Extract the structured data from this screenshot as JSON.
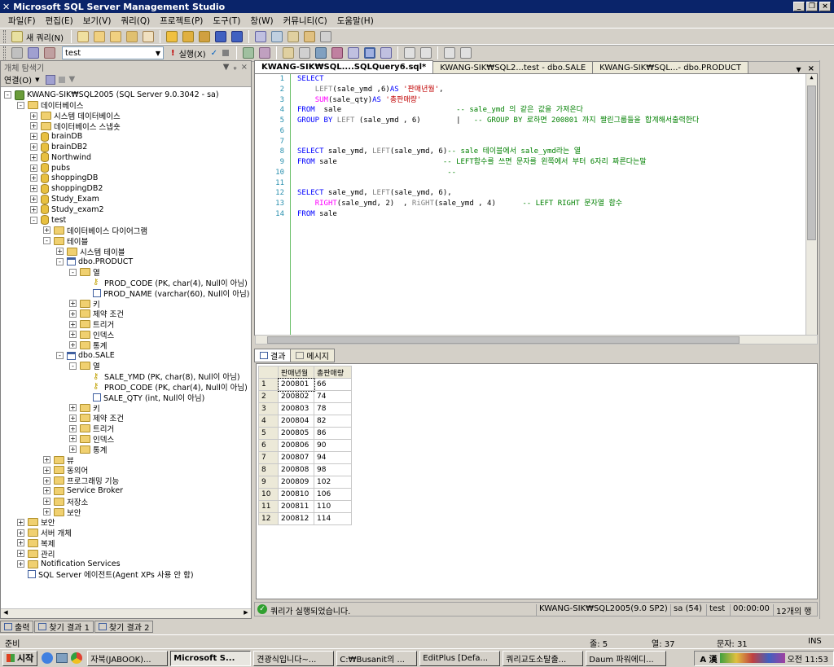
{
  "window": {
    "title": "Microsoft SQL Server Management Studio"
  },
  "menu": [
    "파일(F)",
    "편집(E)",
    "보기(V)",
    "쿼리(Q)",
    "프로젝트(P)",
    "도구(T)",
    "창(W)",
    "커뮤니티(C)",
    "도움말(H)"
  ],
  "toolbar1": {
    "new_query": "새 쿼리(N)"
  },
  "toolbar2": {
    "database": "test",
    "execute": "실행(X)"
  },
  "object_explorer": {
    "title": "개체 탐색기",
    "connect": "연결(O)",
    "tree": [
      {
        "level": 0,
        "exp": "-",
        "icon": "srv",
        "label": "KWANG-SIK₩SQL2005 (SQL Server 9.0.3042 - sa)"
      },
      {
        "level": 1,
        "exp": "-",
        "icon": "fold",
        "label": "데이터베이스"
      },
      {
        "level": 2,
        "exp": "+",
        "icon": "fold",
        "label": "시스템 데이터베이스"
      },
      {
        "level": 2,
        "exp": "+",
        "icon": "fold",
        "label": "데이터베이스 스냅숏"
      },
      {
        "level": 2,
        "exp": "+",
        "icon": "db",
        "label": "brainDB"
      },
      {
        "level": 2,
        "exp": "+",
        "icon": "db",
        "label": "brainDB2"
      },
      {
        "level": 2,
        "exp": "+",
        "icon": "db",
        "label": "Northwind"
      },
      {
        "level": 2,
        "exp": "+",
        "icon": "db",
        "label": "pubs"
      },
      {
        "level": 2,
        "exp": "+",
        "icon": "db",
        "label": "shoppingDB"
      },
      {
        "level": 2,
        "exp": "+",
        "icon": "db",
        "label": "shoppingDB2"
      },
      {
        "level": 2,
        "exp": "+",
        "icon": "db",
        "label": "Study_Exam"
      },
      {
        "level": 2,
        "exp": "+",
        "icon": "db",
        "label": "Study_exam2"
      },
      {
        "level": 2,
        "exp": "-",
        "icon": "db",
        "label": "test"
      },
      {
        "level": 3,
        "exp": "+",
        "icon": "fold",
        "label": "데이터베이스 다이어그램"
      },
      {
        "level": 3,
        "exp": "-",
        "icon": "fold",
        "label": "테이블"
      },
      {
        "level": 4,
        "exp": "+",
        "icon": "fold",
        "label": "시스템 테이블"
      },
      {
        "level": 4,
        "exp": "-",
        "icon": "tbl",
        "label": "dbo.PRODUCT"
      },
      {
        "level": 5,
        "exp": "-",
        "icon": "fold",
        "label": "열"
      },
      {
        "level": 6,
        "exp": "",
        "icon": "key",
        "label": "PROD_CODE (PK, char(4), Null이 아님)"
      },
      {
        "level": 6,
        "exp": "",
        "icon": "col",
        "label": "PROD_NAME (varchar(60), Null이 아님)"
      },
      {
        "level": 5,
        "exp": "+",
        "icon": "fold",
        "label": "키"
      },
      {
        "level": 5,
        "exp": "+",
        "icon": "fold",
        "label": "제약 조건"
      },
      {
        "level": 5,
        "exp": "+",
        "icon": "fold",
        "label": "트리거"
      },
      {
        "level": 5,
        "exp": "+",
        "icon": "fold",
        "label": "인덱스"
      },
      {
        "level": 5,
        "exp": "+",
        "icon": "fold",
        "label": "통계"
      },
      {
        "level": 4,
        "exp": "-",
        "icon": "tbl",
        "label": "dbo.SALE"
      },
      {
        "level": 5,
        "exp": "-",
        "icon": "fold",
        "label": "열"
      },
      {
        "level": 6,
        "exp": "",
        "icon": "key",
        "label": "SALE_YMD (PK, char(8), Null이 아님)"
      },
      {
        "level": 6,
        "exp": "",
        "icon": "key",
        "label": "PROD_CODE (PK, char(4), Null이 아님)"
      },
      {
        "level": 6,
        "exp": "",
        "icon": "col",
        "label": "SALE_QTY (int, Null이 아님)"
      },
      {
        "level": 5,
        "exp": "+",
        "icon": "fold",
        "label": "키"
      },
      {
        "level": 5,
        "exp": "+",
        "icon": "fold",
        "label": "제약 조건"
      },
      {
        "level": 5,
        "exp": "+",
        "icon": "fold",
        "label": "트리거"
      },
      {
        "level": 5,
        "exp": "+",
        "icon": "fold",
        "label": "인덱스"
      },
      {
        "level": 5,
        "exp": "+",
        "icon": "fold",
        "label": "통계"
      },
      {
        "level": 3,
        "exp": "+",
        "icon": "fold",
        "label": "뷰"
      },
      {
        "level": 3,
        "exp": "+",
        "icon": "fold",
        "label": "동의어"
      },
      {
        "level": 3,
        "exp": "+",
        "icon": "fold",
        "label": "프로그래밍 기능"
      },
      {
        "level": 3,
        "exp": "+",
        "icon": "fold",
        "label": "Service Broker"
      },
      {
        "level": 3,
        "exp": "+",
        "icon": "fold",
        "label": "저장소"
      },
      {
        "level": 3,
        "exp": "+",
        "icon": "fold",
        "label": "보안"
      },
      {
        "level": 1,
        "exp": "+",
        "icon": "fold",
        "label": "보안"
      },
      {
        "level": 1,
        "exp": "+",
        "icon": "fold",
        "label": "서버 개체"
      },
      {
        "level": 1,
        "exp": "+",
        "icon": "fold",
        "label": "복제"
      },
      {
        "level": 1,
        "exp": "+",
        "icon": "fold",
        "label": "관리"
      },
      {
        "level": 1,
        "exp": "+",
        "icon": "fold",
        "label": "Notification Services"
      },
      {
        "level": 1,
        "exp": "",
        "icon": "col",
        "label": "SQL Server 에이전트(Agent XPs 사용 안 함)"
      }
    ]
  },
  "editor_tabs": [
    "KWANG-SIK₩SQL....SQLQuery6.sql*",
    "KWANG-SIK₩SQL2...test - dbo.SALE",
    "KWANG-SIK₩SQL...- dbo.PRODUCT"
  ],
  "code_lines": [
    [
      [
        "kw",
        "SELECT"
      ]
    ],
    [
      [
        "",
        "    "
      ],
      [
        "gr",
        "LEFT"
      ],
      [
        "",
        "(sale_ymd ,6)"
      ],
      [
        "kw",
        "AS"
      ],
      [
        "st",
        " '판매년월'"
      ],
      [
        "",
        ","
      ]
    ],
    [
      [
        "",
        "    "
      ],
      [
        "fn",
        "SUM"
      ],
      [
        "",
        "(sale_qty)"
      ],
      [
        "kw",
        "AS"
      ],
      [
        "st",
        " '총판매량'"
      ]
    ],
    [
      [
        "kw",
        "FROM"
      ],
      [
        "",
        "  sale                          "
      ],
      [
        "cm",
        "-- sale_ymd 의 같은 값을 가져온다"
      ]
    ],
    [
      [
        "kw",
        "GROUP BY"
      ],
      [
        "gr",
        " LEFT"
      ],
      [
        "",
        " (sale_ymd , 6)        |   "
      ],
      [
        "cm",
        "-- GROUP BY 로하면 200801 까지 짤린그룹들을 합계해서출력한다"
      ]
    ],
    [],
    [],
    [
      [
        "kw",
        "SELECT"
      ],
      [
        "",
        " sale_ymd, "
      ],
      [
        "gr",
        "LEFT"
      ],
      [
        "",
        "(sale_ymd, 6)"
      ],
      [
        "cm",
        "-- sale 테이블에서 sale_ymd라는 열"
      ]
    ],
    [
      [
        "kw",
        "FROM"
      ],
      [
        "",
        " sale                        "
      ],
      [
        "cm",
        "-- LEFT함수를 쓰면 문자를 왼쪽에서 부터 6자리 짜른다는말"
      ]
    ],
    [
      [
        "",
        "                                  "
      ],
      [
        "cm",
        "--"
      ]
    ],
    [],
    [
      [
        "kw",
        "SELECT"
      ],
      [
        "",
        " sale_ymd, "
      ],
      [
        "gr",
        "LEFT"
      ],
      [
        "",
        "(sale_ymd, 6),"
      ]
    ],
    [
      [
        "",
        "    "
      ],
      [
        "fn",
        "RIGHT"
      ],
      [
        "",
        "(sale_ymd, 2)  , "
      ],
      [
        "gr",
        "RiGHT"
      ],
      [
        "",
        "(sale_ymd , 4)      "
      ],
      [
        "cm",
        "-- LEFT RIGHT 문자열 함수"
      ]
    ],
    [
      [
        "kw",
        "FROM"
      ],
      [
        "",
        " sale"
      ]
    ]
  ],
  "results_tabs": {
    "results": "결과",
    "messages": "메시지"
  },
  "grid": {
    "headers": [
      "판매년월",
      "총판매량"
    ],
    "rows": [
      [
        "1",
        "200801",
        "66"
      ],
      [
        "2",
        "200802",
        "74"
      ],
      [
        "3",
        "200803",
        "78"
      ],
      [
        "4",
        "200804",
        "82"
      ],
      [
        "5",
        "200805",
        "86"
      ],
      [
        "6",
        "200806",
        "90"
      ],
      [
        "7",
        "200807",
        "94"
      ],
      [
        "8",
        "200808",
        "98"
      ],
      [
        "9",
        "200809",
        "102"
      ],
      [
        "10",
        "200810",
        "106"
      ],
      [
        "11",
        "200811",
        "110"
      ],
      [
        "12",
        "200812",
        "114"
      ]
    ]
  },
  "query_status": {
    "message": "쿼리가 실행되었습니다.",
    "server": "KWANG-SIK₩SQL2005(9.0 SP2)",
    "user": "sa (54)",
    "db": "test",
    "time": "00:00:00",
    "rows": "12개의 행"
  },
  "bottom_tabs": [
    "출력",
    "찾기 결과 1",
    "찾기 결과 2"
  ],
  "statusbar": {
    "ready": "준비",
    "line": "줄: 5",
    "col": "열: 37",
    "ch": "문자: 31",
    "ins": "INS"
  },
  "taskbar": {
    "start": "시작",
    "tasks": [
      "자북(JABOOK)...",
      "Microsoft S...",
      "견광식입니다~...",
      "C:₩Busanit의 ...",
      "EditPlus [Defa...",
      "쿼리교도소탈출...",
      "Daum 파워에디..."
    ],
    "clock": "오전 11:53"
  }
}
